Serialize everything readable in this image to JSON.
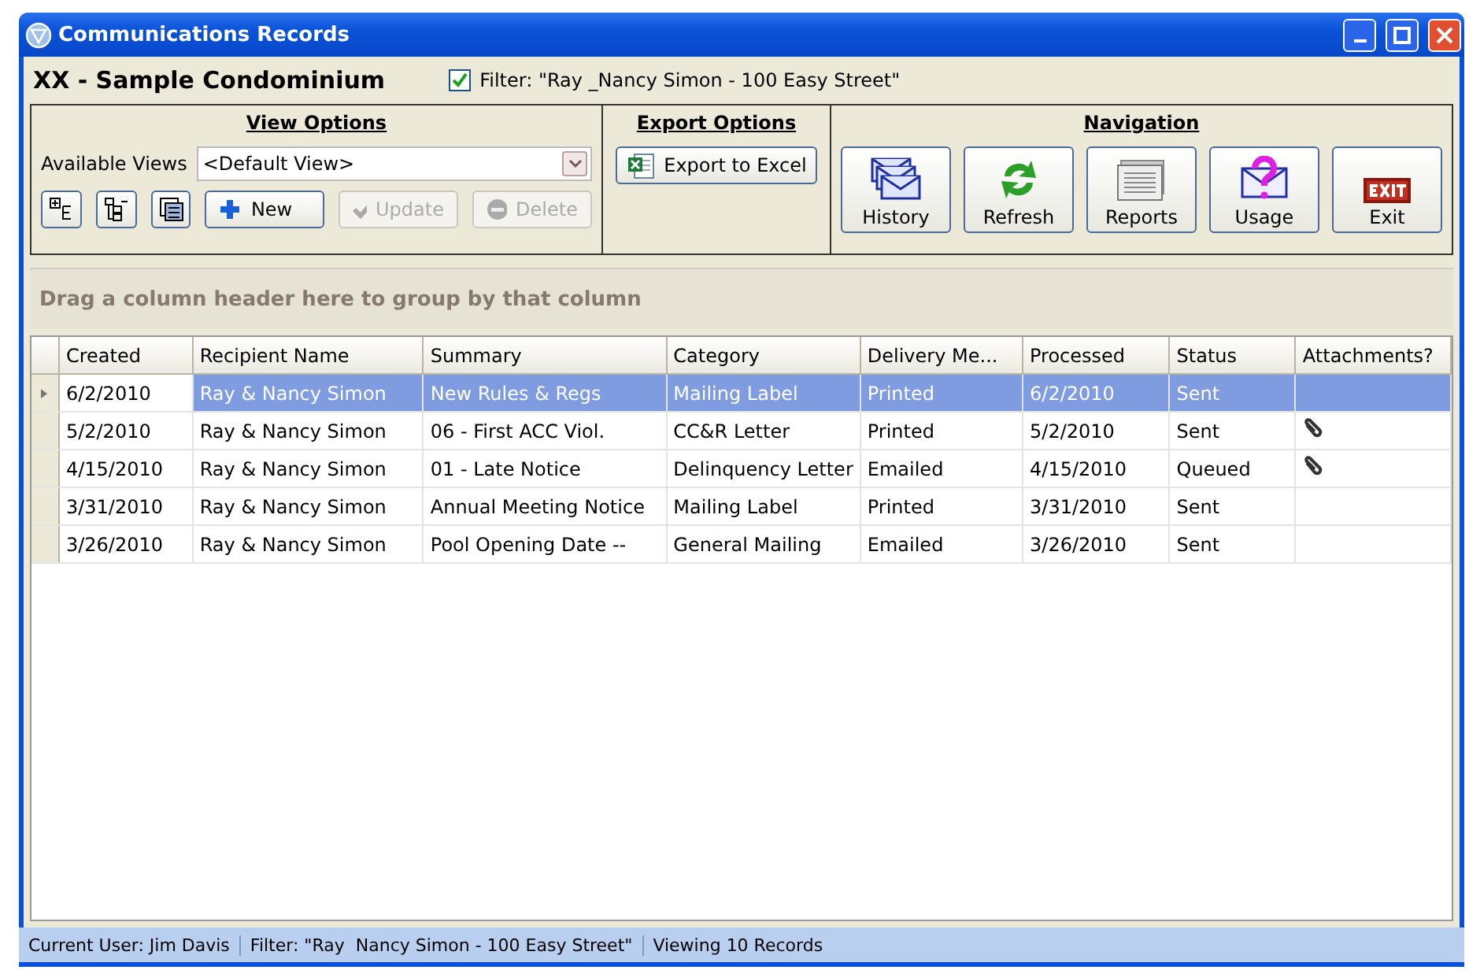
{
  "window": {
    "title": "Communications Records"
  },
  "header": {
    "association": "XX - Sample Condominium",
    "filter": {
      "checked": true,
      "label": "Filter: \"Ray _Nancy Simon - 100 Easy Street\""
    }
  },
  "view_options": {
    "title": "View Options",
    "available_views_label": "Available Views",
    "view": "<Default View>",
    "buttons": [
      {
        "label": "New",
        "kind": "new",
        "disabled": false
      },
      {
        "label": "Update",
        "kind": "update",
        "disabled": true
      },
      {
        "label": "Delete",
        "kind": "delete",
        "disabled": true
      }
    ]
  },
  "export_options": {
    "title": "Export Options",
    "button": "Export to Excel"
  },
  "navigation": {
    "title": "Navigation",
    "buttons": [
      {
        "label": "History",
        "kind": "history"
      },
      {
        "label": "Refresh",
        "kind": "refresh"
      },
      {
        "label": "Reports",
        "kind": "reports"
      },
      {
        "label": "Usage",
        "kind": "usage"
      },
      {
        "label": "Exit",
        "kind": "exit"
      }
    ]
  },
  "group_hint": "Drag a column header here to group by that column",
  "table": {
    "columns": [
      "Created",
      "Recipient Name",
      "Summary",
      "Category",
      "Delivery Me...",
      "Processed",
      "Status",
      "Attachments?"
    ],
    "rows": [
      {
        "cells": [
          "6/2/2010",
          "Ray & Nancy Simon",
          "New Rules & Regs",
          "Mailing Label",
          "Printed",
          "6/2/2010",
          "Sent"
        ],
        "attachment": false,
        "selected": true
      },
      {
        "cells": [
          "5/2/2010",
          "Ray & Nancy Simon",
          "06 - First ACC Viol.",
          "CC&R Letter",
          "Printed",
          "5/2/2010",
          "Sent"
        ],
        "attachment": true,
        "selected": false
      },
      {
        "cells": [
          "4/15/2010",
          "Ray & Nancy Simon",
          "01 - Late Notice",
          "Delinquency Letter",
          "Emailed",
          "4/15/2010",
          "Queued"
        ],
        "attachment": true,
        "selected": false
      },
      {
        "cells": [
          "3/31/2010",
          "Ray & Nancy Simon",
          "Annual Meeting Notice",
          "Mailing Label",
          "Printed",
          "3/31/2010",
          "Sent"
        ],
        "attachment": false,
        "selected": false
      },
      {
        "cells": [
          "3/26/2010",
          "Ray & Nancy Simon",
          "Pool Opening Date --",
          "General Mailing",
          "Emailed",
          "3/26/2010",
          "Sent"
        ],
        "attachment": false,
        "selected": false
      }
    ]
  },
  "status_bar": [
    "Current User: Jim Davis",
    "Filter: \"Ray  Nancy Simon - 100 Easy Street\"",
    "Viewing 10 Records"
  ]
}
